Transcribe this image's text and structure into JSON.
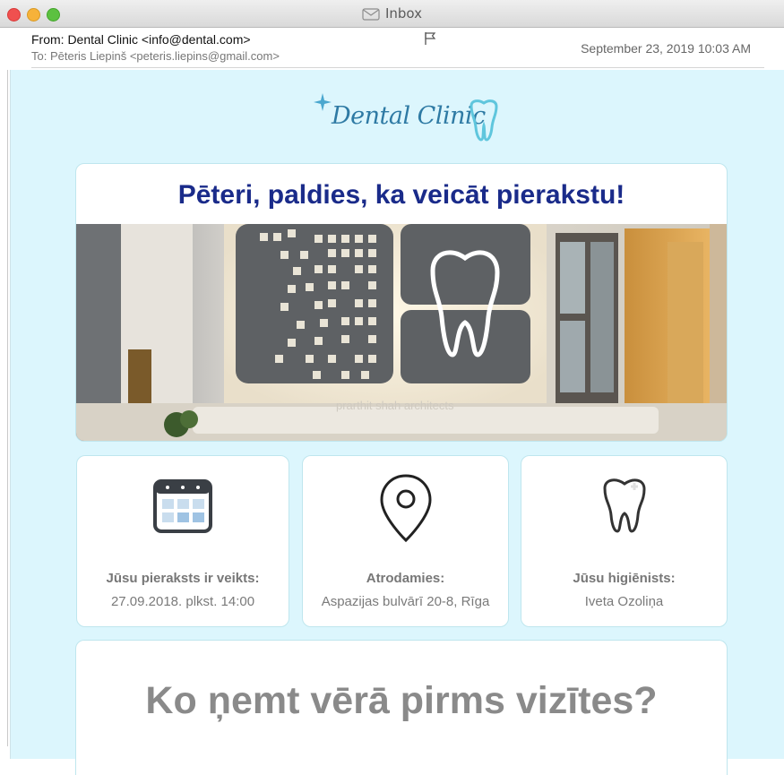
{
  "window": {
    "title": "Inbox"
  },
  "header": {
    "from": "From: Dental Clinic <info@dental.com>",
    "to": "To: Pēteris Liepinš <peteris.liepins@gmail.com>",
    "date": "September 23, 2019 10:03 AM"
  },
  "brand": {
    "logo_text": "Dental Clinic",
    "accent": "#2e7aa4",
    "background": "#dcf6fd"
  },
  "hero": {
    "title": "Pēteri, paldies, ka veicāt pierakstu!",
    "watermark": "prarthit shah architects",
    "title_color": "#1a2b8a"
  },
  "info": [
    {
      "icon": "calendar-icon",
      "label": "Jūsu pieraksts ir veikts:",
      "value": "27.09.2018. plkst. 14:00"
    },
    {
      "icon": "location-pin-icon",
      "label": "Atrodamies:",
      "value": "Aspazijas bulvārī 20-8, Rīga"
    },
    {
      "icon": "tooth-icon",
      "label": "Jūsu higiēnists:",
      "value": "Iveta Ozoliņa"
    }
  ],
  "section": {
    "title": "Ko ņemt vērā pirms vizītes?"
  }
}
